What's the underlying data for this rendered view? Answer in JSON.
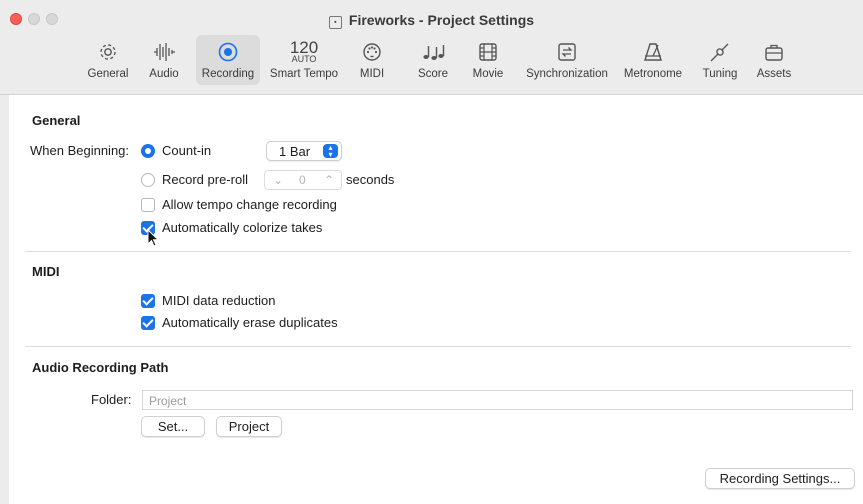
{
  "window": {
    "title": "Fireworks - Project Settings"
  },
  "toolbar": {
    "items": [
      {
        "label": "General",
        "icon": "gear-icon"
      },
      {
        "label": "Audio",
        "icon": "waveform-icon"
      },
      {
        "label": "Recording",
        "icon": "record-icon",
        "selected": true
      },
      {
        "label": "Smart Tempo",
        "icon": "tempo-display",
        "tempo": "120",
        "mode": "AUTO"
      },
      {
        "label": "MIDI",
        "icon": "midi-port-icon"
      },
      {
        "label": "Score",
        "icon": "notes-icon"
      },
      {
        "label": "Movie",
        "icon": "film-icon"
      },
      {
        "label": "Synchronization",
        "icon": "sync-icon"
      },
      {
        "label": "Metronome",
        "icon": "metronome-icon"
      },
      {
        "label": "Tuning",
        "icon": "tuning-fork-icon"
      },
      {
        "label": "Assets",
        "icon": "briefcase-icon"
      }
    ]
  },
  "general": {
    "heading": "General",
    "when_beginning_label": "When Beginning:",
    "count_in_label": "Count-in",
    "count_in_value": "1 Bar",
    "record_preroll_label": "Record pre-roll",
    "preroll_value": "0",
    "seconds_label": "seconds",
    "allow_tempo_label": "Allow tempo change recording",
    "colorize_label": "Automatically colorize takes"
  },
  "midi": {
    "heading": "MIDI",
    "data_reduction_label": "MIDI data reduction",
    "erase_duplicates_label": "Automatically erase duplicates"
  },
  "audio_path": {
    "heading": "Audio Recording Path",
    "folder_label": "Folder:",
    "folder_placeholder": "Project",
    "set_button": "Set...",
    "project_button": "Project"
  },
  "footer": {
    "recording_settings_button": "Recording Settings..."
  },
  "colors": {
    "accent": "#1a73e8",
    "close": "#ff5f57"
  }
}
